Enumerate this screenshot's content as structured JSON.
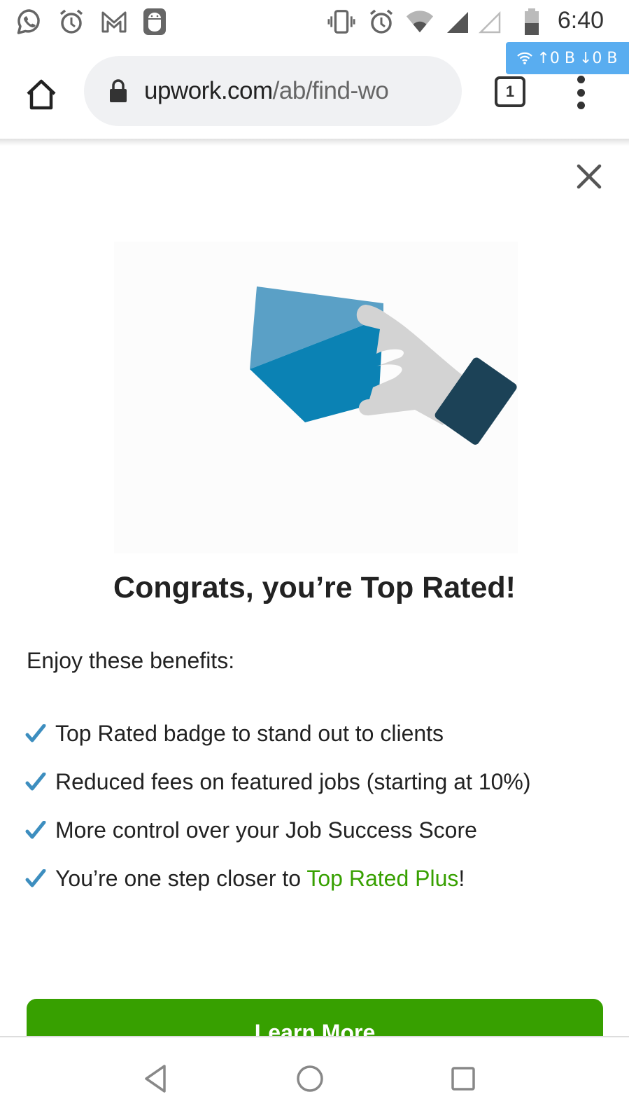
{
  "status_bar": {
    "left_icons": [
      "whatsapp-icon",
      "alarm-icon",
      "gmail-icon",
      "android-icon"
    ],
    "right_icons": [
      "vibrate-icon",
      "alarm-icon",
      "wifi-icon",
      "signal-icon",
      "signal-empty-icon",
      "battery-icon"
    ],
    "time": "6:40",
    "battery_level_percent": 50
  },
  "speed_badge": {
    "upload": "↑0 B",
    "download": "↓0 B"
  },
  "browser": {
    "url_host": "upwork.com",
    "url_path": "/ab/find-wo",
    "tab_count": "1"
  },
  "modal": {
    "title": "Congrats, you’re Top Rated!",
    "intro": "Enjoy these benefits:",
    "benefits": [
      {
        "text": "Top Rated badge to stand out to clients"
      },
      {
        "text": "Reduced fees on featured jobs (starting at 10%)"
      },
      {
        "text": "More control over your Job Success Score"
      },
      {
        "text_before": "You’re one step closer to ",
        "link": "Top Rated Plus",
        "text_after": "!"
      }
    ],
    "button_label": "Learn More",
    "colors": {
      "accent_green": "#37a000",
      "check_blue": "#3d8ebf",
      "gem_light": "#5aa0c6",
      "gem_dark": "#0b82b4",
      "hand_gray": "#d3d3d3",
      "cuff_navy": "#1c4257"
    }
  },
  "nav_bar": {
    "buttons": [
      "back-icon",
      "home-icon",
      "recents-icon"
    ]
  }
}
